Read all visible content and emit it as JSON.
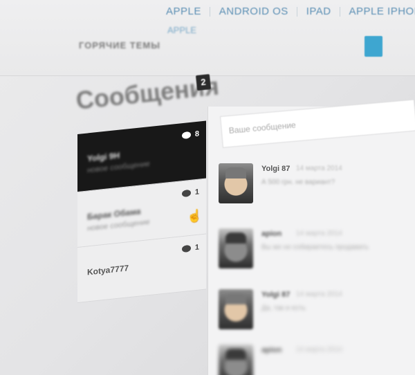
{
  "nav": {
    "links": [
      "APPLE",
      "ANDROID OS",
      "IPAD",
      "APPLE IPHONE"
    ],
    "hot_label": "ГОРЯЧИЕ ТЕМЫ",
    "hot_tag": "APPLE"
  },
  "header": {
    "title": "Сообщения",
    "badge": "2"
  },
  "conversations": [
    {
      "name": "Yolgi 9H",
      "preview": "новое сообщение",
      "count": "8",
      "active": true
    },
    {
      "name": "Барак Обама",
      "preview": "новое сообщение",
      "count": "1",
      "active": false
    },
    {
      "name": "Kotya7777",
      "preview": "",
      "count": "1",
      "active": false
    }
  ],
  "thread": {
    "input_placeholder": "Ваше сообщение",
    "messages": [
      {
        "author": "Yolgi 87",
        "date": "14 марта 2014",
        "text": "А 500 грн. не вариант?"
      },
      {
        "author": "apion",
        "date": "14 марта 2014",
        "text": "Вы же не собираетесь продавать"
      },
      {
        "author": "Yolgi 87",
        "date": "14 марта 2014",
        "text": "Да, так и есть"
      },
      {
        "author": "apion",
        "date": "14 марта 2014",
        "text": ""
      }
    ]
  },
  "colors": {
    "accent": "#3ea6d0",
    "nav_link": "#5b8fb4",
    "active_item": "#181818"
  }
}
